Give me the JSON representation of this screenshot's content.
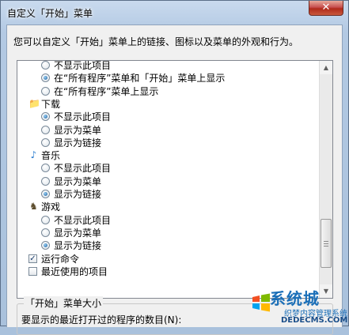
{
  "window": {
    "title": "自定义「开始」菜单",
    "close_label": "✕"
  },
  "description": "您可以自定义「开始」菜单上的链接、图标以及菜单的外观和行为。",
  "list": {
    "rows": [
      {
        "kind": "radio",
        "checked": false,
        "label": "不显示此项目"
      },
      {
        "kind": "radio",
        "checked": true,
        "label": "在“所有程序”菜单和「开始」菜单上显示"
      },
      {
        "kind": "radio",
        "checked": false,
        "label": "在“所有程序”菜单上显示"
      },
      {
        "kind": "category",
        "icon": "folder-icon",
        "label": "下载"
      },
      {
        "kind": "radio",
        "checked": true,
        "label": "不显示此项目"
      },
      {
        "kind": "radio",
        "checked": false,
        "label": "显示为菜单"
      },
      {
        "kind": "radio",
        "checked": false,
        "label": "显示为链接"
      },
      {
        "kind": "category",
        "icon": "music-note-icon",
        "label": "音乐"
      },
      {
        "kind": "radio",
        "checked": false,
        "label": "不显示此项目"
      },
      {
        "kind": "radio",
        "checked": false,
        "label": "显示为菜单"
      },
      {
        "kind": "radio",
        "checked": true,
        "label": "显示为链接"
      },
      {
        "kind": "category",
        "icon": "games-icon",
        "label": "游戏"
      },
      {
        "kind": "radio",
        "checked": false,
        "label": "不显示此项目"
      },
      {
        "kind": "radio",
        "checked": false,
        "label": "显示为菜单"
      },
      {
        "kind": "radio",
        "checked": true,
        "label": "显示为链接"
      },
      {
        "kind": "checkbox",
        "checked": true,
        "label": "运行命令"
      },
      {
        "kind": "checkbox",
        "checked": false,
        "label": "最近使用的项目"
      }
    ]
  },
  "start_menu_size": {
    "title": "「开始」菜单大小",
    "recent_programs_label": "要显示的最近打开过的程序的数目(N):"
  },
  "watermark": {
    "brand": "系统城",
    "tagline": "织梦内容管理系统",
    "url": "DEDECMS.COM"
  }
}
